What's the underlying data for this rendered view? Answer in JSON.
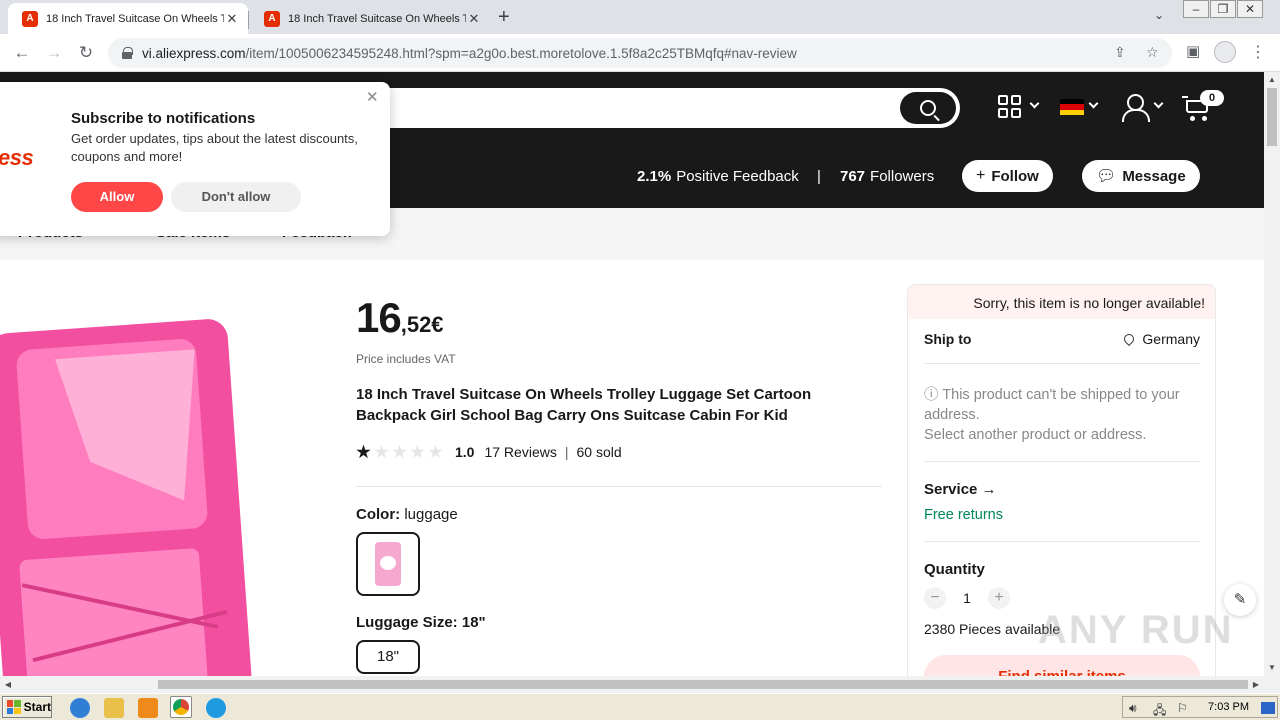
{
  "browser": {
    "tabs": [
      {
        "title": "18 Inch Travel Suitcase On Wheels Tr",
        "active": true
      },
      {
        "title": "18 Inch Travel Suitcase On Wheels Tr",
        "active": false
      }
    ],
    "url_host": "vi.aliexpress.com",
    "url_path": "/item/1005006234595248.html?spm=a2g0o.best.moretolove.1.5f8a2c25TBMqfq#nav-review"
  },
  "header": {
    "cart_count": "0",
    "positive_feedback_value": "2.1%",
    "positive_feedback_label": "Positive Feedback",
    "followers_value": "767",
    "followers_label": "Followers",
    "follow_label": "Follow",
    "message_label": "Message"
  },
  "store_nav": {
    "items": [
      "Products",
      "Sale Items",
      "Feedback"
    ]
  },
  "notification": {
    "logo_text": "ress",
    "title": "Subscribe to notifications",
    "text": "Get order updates, tips about the latest discounts, coupons and more!",
    "allow_label": "Allow",
    "deny_label": "Don't allow"
  },
  "product": {
    "price_int": "16",
    "price_dec": ",52€",
    "vat_note": "Price includes VAT",
    "title": "18 Inch Travel Suitcase On Wheels Trolley Luggage Set Cartoon Backpack Girl School Bag Carry Ons Suitcase Cabin For Kid",
    "rating_stars": 1,
    "rating_value": "1.0",
    "reviews": "17 Reviews",
    "sold": "60 sold",
    "color_label": "Color:",
    "color_value": "luggage",
    "size_label": "Luggage Size:",
    "size_value": "18\"",
    "size_option": "18\""
  },
  "sidebar": {
    "unavailable": "Sorry, this item is no longer available!",
    "ship_to_label": "Ship to",
    "ship_to_value": "Germany",
    "warning_line1": "ⓘ This product can't be shipped to your address.",
    "warning_line2": "Select another product or address.",
    "service_label": "Service →",
    "free_returns": "Free returns",
    "quantity_label": "Quantity",
    "quantity_value": "1",
    "pieces_available": "2380 Pieces available",
    "find_similar": "Find similar items"
  },
  "watermark": "ANY RUN",
  "taskbar": {
    "start_label": "Start",
    "clock": "7:03 PM"
  },
  "colors": {
    "accent_red": "#e62e04",
    "allow_red": "#ff4747",
    "dark_header": "#191919",
    "free_returns_green": "#00875a"
  }
}
